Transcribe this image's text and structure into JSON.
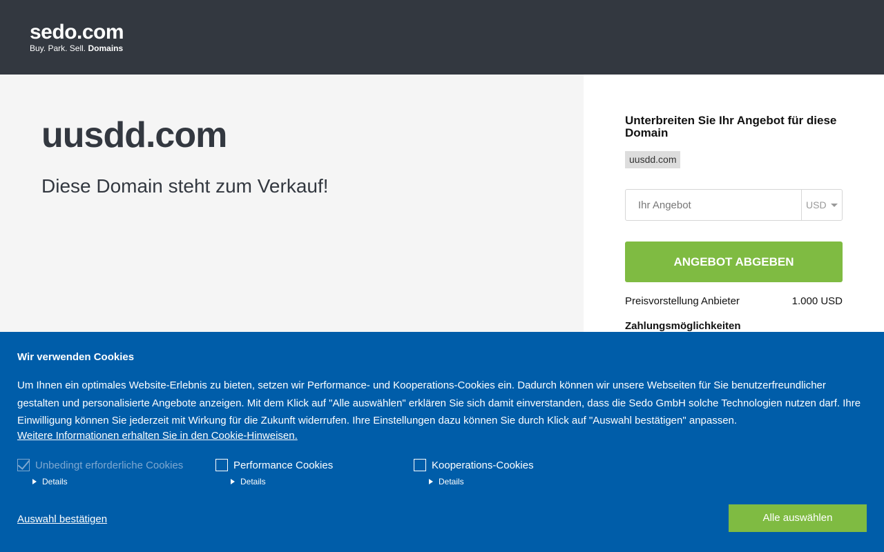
{
  "header": {
    "logo_main": "sedo.com",
    "logo_tag_prefix": "Buy. Park. Sell.",
    "logo_tag_bold": "Domains"
  },
  "main": {
    "domain": "uusdd.com",
    "subtitle": "Diese Domain steht zum Verkauf!"
  },
  "offer": {
    "heading": "Unterbreiten Sie Ihr Angebot für diese Domain",
    "domain_badge": "uusdd.com",
    "input_placeholder": "Ihr Angebot",
    "currency": "USD",
    "submit_label": "ANGEBOT ABGEBEN",
    "price_label": "Preisvorstellung Anbieter",
    "price_value": "1.000 USD",
    "payment_label": "Zahlungsmöglichkeiten"
  },
  "cookie": {
    "title": "Wir verwenden Cookies",
    "text": "Um Ihnen ein optimales Website-Erlebnis zu bieten, setzen wir Performance- und Kooperations-Cookies ein. Dadurch können wir unsere Webseiten für Sie benutzerfreundlicher gestalten und personalisierte Angebote anzeigen. Mit dem Klick auf \"Alle auswählen\" erklären Sie sich damit einverstanden, dass die Sedo GmbH solche Technologien nutzen darf. Ihre Einwilligung können Sie jederzeit mit Wirkung für die Zukunft widerrufen. Ihre Einstellungen dazu können Sie durch Klick auf \"Auswahl bestätigen\" anpassen.",
    "more_info_link": "Weitere Informationen erhalten Sie in den Cookie-Hinweisen.",
    "options": [
      {
        "label": "Unbedingt erforderliche Cookies",
        "details": "Details",
        "checked": true
      },
      {
        "label": "Performance Cookies",
        "details": "Details",
        "checked": false
      },
      {
        "label": "Kooperations-Cookies",
        "details": "Details",
        "checked": false
      }
    ],
    "confirm_label": "Auswahl bestätigen",
    "accept_all_label": "Alle auswählen"
  }
}
